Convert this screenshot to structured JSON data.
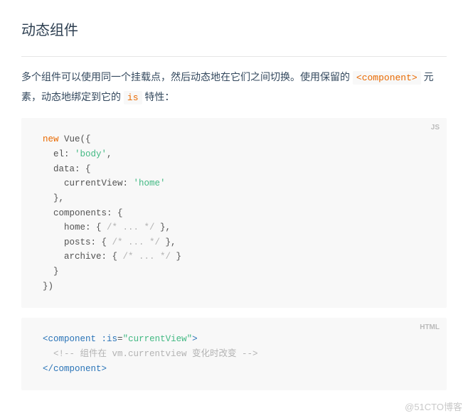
{
  "heading": "动态组件",
  "para": {
    "seg1": "多个组件可以使用同一个挂载点，然后动态地在它们之间切换。使用保留的 ",
    "code1": "<component>",
    "seg2": " 元素，动态地绑定到它的 ",
    "code2": "is",
    "seg3": " 特性："
  },
  "block1": {
    "lang": "JS",
    "l1a": "new",
    "l1b": " Vue({",
    "l2a": "  el: ",
    "l2b": "'body'",
    "l2c": ",",
    "l3": "  data: {",
    "l4a": "    currentView: ",
    "l4b": "'home'",
    "l5": "  },",
    "l6": "  components: {",
    "l7a": "    home: { ",
    "l7b": "/* ... */",
    "l7c": " },",
    "l8a": "    posts: { ",
    "l8b": "/* ... */",
    "l8c": " },",
    "l9a": "    archive: { ",
    "l9b": "/* ... */",
    "l9c": " }",
    "l10": "  }",
    "l11": "})"
  },
  "block2": {
    "lang": "HTML",
    "l1a": "<",
    "l1b": "component",
    "l1c": " :is",
    "l1d": "=",
    "l1e": "\"currentView\"",
    "l1f": ">",
    "l2a": "  ",
    "l2b": "<!-- 组件在 vm.currentview 变化时改变 -->",
    "l3a": "</",
    "l3b": "component",
    "l3c": ">"
  },
  "watermark": "@51CTO博客"
}
